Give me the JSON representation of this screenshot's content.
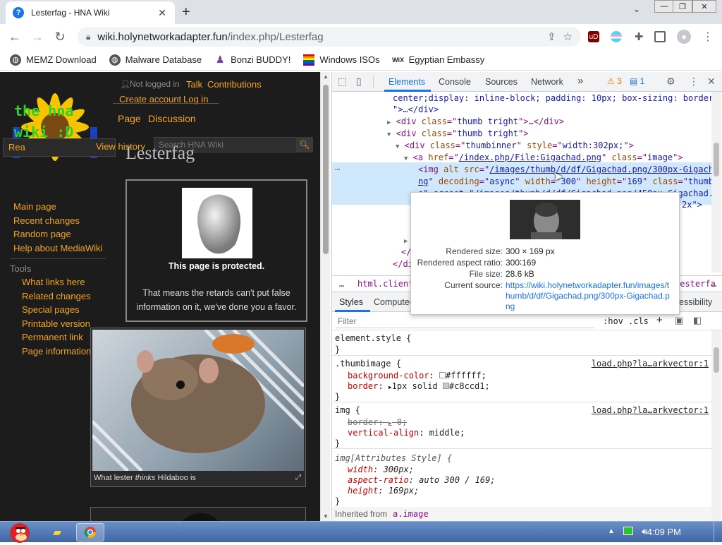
{
  "browser": {
    "tab_title": "Lesterfag - HNA Wiki",
    "url_host": "wiki.holynetworkadapter.fun",
    "url_path": "/index.php/Lesterfag",
    "bookmarks": [
      {
        "label": "MEMZ Download",
        "icon": "globe-icon"
      },
      {
        "label": "Malware Database",
        "icon": "globe-icon"
      },
      {
        "label": "Bonzi BUDDY!",
        "icon": "bonzi-icon"
      },
      {
        "label": "Windows ISOs",
        "icon": "windows-flag-icon"
      },
      {
        "label": "Egyptian Embassy",
        "icon": "wix-icon"
      }
    ],
    "wix_badge": "WiX",
    "ublock_badge": "uD"
  },
  "wiki": {
    "logo_text_line1": "the hna",
    "logo_text_line2": "wiki :D",
    "personal": {
      "not_logged_in": "Not logged in",
      "talk": "Talk",
      "contributions": "Contributions",
      "create_account": "Create account",
      "log_in": "Log in"
    },
    "tabs": {
      "page": "Page",
      "discussion": "Discussion",
      "read": "Rea",
      "view_history": "View history"
    },
    "search_placeholder": "Search HNA Wiki",
    "heading": "Lesterfag",
    "nav": [
      "Main page",
      "Recent changes",
      "Random page",
      "Help about MediaWiki"
    ],
    "tools_heading": "Tools",
    "tools": [
      "What links here",
      "Related changes",
      "Special pages",
      "Printable version",
      "Permanent link",
      "Page information"
    ],
    "protect_title": "This page is protected.",
    "protect_text_1": "That means the retards can't put false",
    "protect_text_2": "information on it, we've done you a favor.",
    "caption_prefix": "What lester ",
    "caption_em": "thinks",
    "caption_suffix": " Hildaboo is"
  },
  "devtools": {
    "tabs": [
      "Elements",
      "Console",
      "Sources",
      "Network"
    ],
    "more": "»",
    "warnings": "3",
    "messages": "1",
    "dom": {
      "l1": "center;display: inline-block; padding: 10px; box-sizing: border-box;",
      "l1b": "\">…</div>",
      "l2_class": "thumb tright",
      "l2_tail": ">…</div>",
      "l3_class": "thumb tright",
      "l4_class": "thumbinner",
      "l4_style": "width:302px;",
      "l5_href": "/index.php/File:Gigachad.png",
      "l5_class": "image",
      "l6_src": "/images/thumb/d/df/Gigachad.png/300px-Gigachad.p",
      "l7a": "ng",
      "l7_decoding": "async",
      "l7_width": "300",
      "l7_height": "169",
      "l7_class": "thumbimag",
      "l8": "e\" srcset=\"/images/thumb/d/df/Gigachad.png/450px-Gigachad.png",
      "l8b": "2x\">",
      "close_div": "</div>",
      "close_div2": "</div>"
    },
    "crumbs": {
      "dots": "…",
      "html": "html.client-js",
      "tail": "lesterfa",
      "dots2": "…"
    },
    "subtabs": {
      "styles": "Styles",
      "computed": "Computed",
      "accessibility": "essibility"
    },
    "filter": {
      "placeholder": "Filter",
      "hov": ":hov",
      "cls": ".cls",
      "plus": "+"
    },
    "styles": {
      "r1_selector": "element.style {",
      "close": "}",
      "r2_selector": ".thumbimage {",
      "r2_src": "load.php?la…arkvector:1",
      "r2_p1": "background-color",
      "r2_v1": "#ffffff",
      "r2_p2": "border",
      "r2_v2": "1px solid",
      "r2_v2b": "#c8ccd1",
      "r3_selector": "img {",
      "r3_src": "load.php?la…arkvector:1",
      "r3_p1": "border",
      "r3_v1": "0",
      "r3_p2": "vertical-align",
      "r3_v2": "middle",
      "r4_selector": "img[Attributes Style] {",
      "r4_p1": "width",
      "r4_v1": "300px",
      "r4_p2": "aspect-ratio",
      "r4_v2": "auto 300 / 169",
      "r4_p3": "height",
      "r4_v3": "169px",
      "inherited_prefix": "Inherited from ",
      "inherited_el": "a.image"
    },
    "tooltip": {
      "rendered_size_label": "Rendered size:",
      "rendered_size": "300 × 169 px",
      "aspect_label": "Rendered aspect ratio:",
      "aspect": "300∶169",
      "file_size_label": "File size:",
      "file_size": "28.6 kB",
      "source_label": "Current source:",
      "source_1": "https://wiki.holynetworkadapter.fun/images/t",
      "source_2": "humb/d/df/Gigachad.png/300px-Gigachad.p",
      "source_3": "ng"
    }
  },
  "taskbar": {
    "time": "4:09 PM"
  }
}
